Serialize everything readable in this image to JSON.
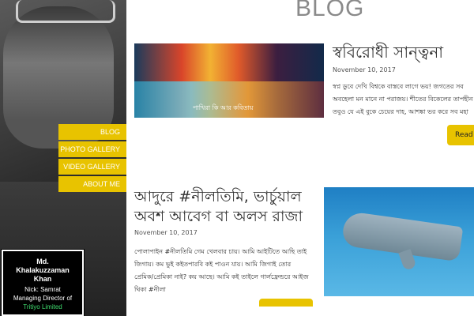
{
  "page": {
    "title": "BLOG"
  },
  "sidebar": {
    "nav": [
      {
        "label": "BLOG"
      },
      {
        "label": "PHOTO GALLERY"
      },
      {
        "label": "VIDEO GALLERY"
      },
      {
        "label": "ABOUT ME"
      }
    ],
    "profile": {
      "name_line1": "Md.",
      "name_line2": "Khalakuzzaman",
      "name_line3": "Khan",
      "nick": "Nick: Samrat",
      "role": "Managing Director of",
      "company": "Tritiyo Limited"
    }
  },
  "posts": [
    {
      "title": "স্ববিরোধী সান্ত্বনা",
      "date": "November 10, 2017",
      "image_caption": "পাখিরা কি আর কবিতায়",
      "excerpt_lines": [
        "স্বপ্ন ডুবে দেখি বিশ্বকে বাস্তবে লাগে ভয়! জগতের সব",
        "অবহেলা মন মানে না পরাজয়। শীতের বিকেলের তাপহীন",
        "তবুও যে এই বুকে চেয়ের দাহ, আশঙ্কা ভর করে সব মহা"
      ],
      "read_more": "Read"
    },
    {
      "title": "আদুরে #নীলতিমি, ভার্চুয়াল অবশ আবেগ বা অলস রাজা",
      "date": "November 10, 2017",
      "excerpt_lines": [
        "পোলাপাইন #নীলতিমি গেম খেলবার চায়। আমি আইটিতে আছি তাই",
        "জিগায়। কম ভুই কইতপারবি কই পাওন যায়। আমি জিগাই তোর",
        "প্রেমিক/প্রেমিকা নাই? কয় আছে। আমি কই তাইলে গার্লফ্রেন্ডরে আইজ",
        "থিকা #নীলা"
      ]
    }
  ],
  "colors": {
    "accent": "#e8c300",
    "company": "#3fdc6e"
  },
  "icons": []
}
